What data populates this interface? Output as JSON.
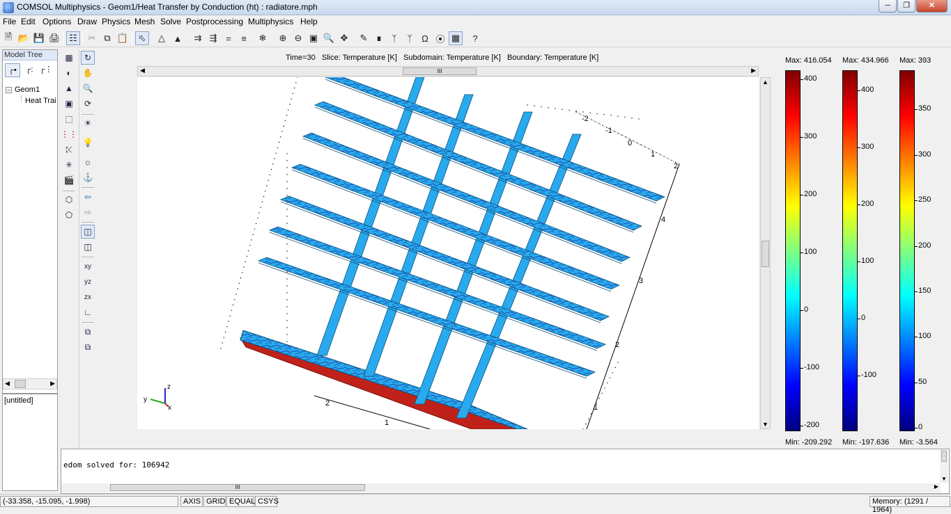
{
  "window": {
    "title": "COMSOL Multiphysics - Geom1/Heat Transfer by Conduction (ht) : radiatore.mph",
    "minimize": "─",
    "maximize": "❐",
    "close": "✕"
  },
  "menu": [
    "File",
    "Edit",
    "Options",
    "Draw",
    "Physics",
    "Mesh",
    "Solve",
    "Postprocessing",
    "Multiphysics",
    "Help"
  ],
  "model_tree": {
    "header": "Model Tree",
    "nodes": [
      "Geom1",
      "Heat Trai"
    ],
    "pane2": "[untitled]"
  },
  "plot": {
    "title": "Time=30   Slice: Temperature [K]   Subdomain: Temperature [K]   Boundary: Temperature [K]",
    "axis_labels": [
      "-2",
      "-1",
      "0",
      "1",
      "2",
      "4",
      "3",
      "2",
      "1",
      "2",
      "1"
    ],
    "triad": {
      "z": "z",
      "y": "y",
      "x": "x"
    }
  },
  "colorbars": [
    {
      "max": "Max: 416.054",
      "min": "Min: -209.292",
      "ticks": [
        "400",
        "300",
        "200",
        "100",
        "0",
        "-100",
        "-200"
      ]
    },
    {
      "max": "Max: 434.966",
      "min": "Min: -197.636",
      "ticks": [
        "400",
        "300",
        "200",
        "100",
        "0",
        "-100"
      ]
    },
    {
      "max": "Max: 393",
      "min": "Min: -3.564",
      "ticks": [
        "350",
        "300",
        "250",
        "200",
        "150",
        "100",
        "50",
        "0"
      ]
    }
  ],
  "log": {
    "text": "edom solved for: 106942"
  },
  "status": {
    "coords": "(-33.358, -15.095, -1.998)",
    "axis": "AXIS",
    "grid": "GRID",
    "equal": "EQUAL",
    "csys": "CSYS",
    "memory": "Memory: (1291 / 1964)"
  },
  "scroll": {
    "grip": "III"
  },
  "colors": {
    "fin": "#29aaee",
    "fin_edge": "#0a4f7a",
    "base": "#c0221a",
    "accent": "#dfe8f6"
  }
}
